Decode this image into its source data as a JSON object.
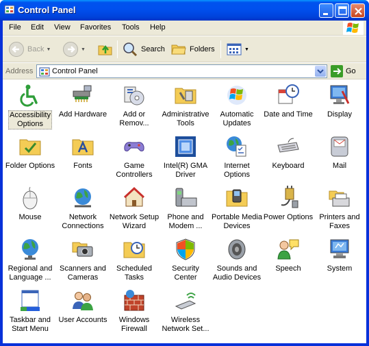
{
  "window": {
    "title": "Control Panel"
  },
  "menu": [
    "File",
    "Edit",
    "View",
    "Favorites",
    "Tools",
    "Help"
  ],
  "toolbar": {
    "back": "Back",
    "search": "Search",
    "folders": "Folders"
  },
  "address": {
    "label": "Address",
    "value": "Control Panel",
    "go": "Go"
  },
  "colors": {
    "titlebar": "#0054e3",
    "toolbar": "#ece9d8",
    "selection": "#ece9d8"
  },
  "items": [
    {
      "label1": "Accessibility",
      "label2": "Options",
      "icon": "accessibility-icon"
    },
    {
      "label1": "Add Hardware",
      "label2": "",
      "icon": "add-hardware-icon"
    },
    {
      "label1": "Add or",
      "label2": "Remov...",
      "icon": "add-remove-programs-icon"
    },
    {
      "label1": "Administrative",
      "label2": "Tools",
      "icon": "administrative-tools-icon"
    },
    {
      "label1": "Automatic",
      "label2": "Updates",
      "icon": "automatic-updates-icon"
    },
    {
      "label1": "Date and Time",
      "label2": "",
      "icon": "date-time-icon"
    },
    {
      "label1": "Display",
      "label2": "",
      "icon": "display-icon"
    },
    {
      "label1": "Folder Options",
      "label2": "",
      "icon": "folder-options-icon"
    },
    {
      "label1": "Fonts",
      "label2": "",
      "icon": "fonts-icon"
    },
    {
      "label1": "Game",
      "label2": "Controllers",
      "icon": "game-controllers-icon"
    },
    {
      "label1": "Intel(R) GMA",
      "label2": "Driver",
      "icon": "intel-gma-icon"
    },
    {
      "label1": "Internet",
      "label2": "Options",
      "icon": "internet-options-icon"
    },
    {
      "label1": "Keyboard",
      "label2": "",
      "icon": "keyboard-icon"
    },
    {
      "label1": "Mail",
      "label2": "",
      "icon": "mail-icon"
    },
    {
      "label1": "Mouse",
      "label2": "",
      "icon": "mouse-icon"
    },
    {
      "label1": "Network",
      "label2": "Connections",
      "icon": "network-connections-icon"
    },
    {
      "label1": "Network Setup",
      "label2": "Wizard",
      "icon": "network-setup-icon"
    },
    {
      "label1": "Phone and",
      "label2": "Modem ...",
      "icon": "phone-modem-icon"
    },
    {
      "label1": "Portable Media",
      "label2": "Devices",
      "icon": "portable-media-icon"
    },
    {
      "label1": "Power Options",
      "label2": "",
      "icon": "power-options-icon"
    },
    {
      "label1": "Printers and",
      "label2": "Faxes",
      "icon": "printers-faxes-icon"
    },
    {
      "label1": "Regional and",
      "label2": "Language ...",
      "icon": "regional-language-icon"
    },
    {
      "label1": "Scanners and",
      "label2": "Cameras",
      "icon": "scanners-cameras-icon"
    },
    {
      "label1": "Scheduled",
      "label2": "Tasks",
      "icon": "scheduled-tasks-icon"
    },
    {
      "label1": "Security",
      "label2": "Center",
      "icon": "security-center-icon"
    },
    {
      "label1": "Sounds and",
      "label2": "Audio Devices",
      "icon": "sounds-audio-icon"
    },
    {
      "label1": "Speech",
      "label2": "",
      "icon": "speech-icon"
    },
    {
      "label1": "System",
      "label2": "",
      "icon": "system-icon"
    },
    {
      "label1": "Taskbar and",
      "label2": "Start Menu",
      "icon": "taskbar-start-menu-icon"
    },
    {
      "label1": "User Accounts",
      "label2": "",
      "icon": "user-accounts-icon"
    },
    {
      "label1": "Windows",
      "label2": "Firewall",
      "icon": "windows-firewall-icon"
    },
    {
      "label1": "Wireless",
      "label2": "Network Set...",
      "icon": "wireless-network-icon"
    }
  ]
}
